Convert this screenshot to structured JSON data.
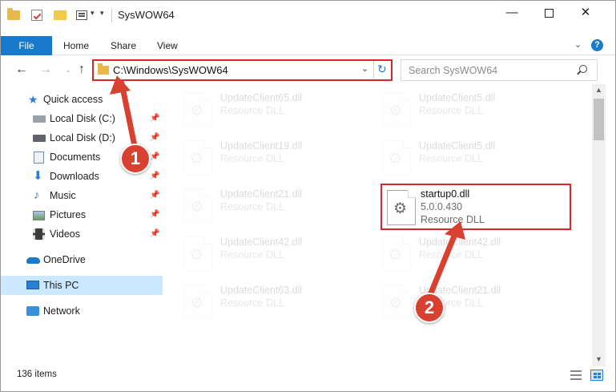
{
  "window": {
    "title": "SysWOW64",
    "controls": {
      "minimize": "—",
      "maximize": "",
      "close": "✕"
    }
  },
  "quick_access_toolbar": {
    "dropdown_glyph": "▾",
    "customize_glyph": "▾"
  },
  "ribbon": {
    "tabs": [
      "File",
      "Home",
      "Share",
      "View"
    ],
    "expand_glyph": "⌄",
    "help_glyph": "?"
  },
  "navigation": {
    "back_glyph": "←",
    "forward_glyph": "→",
    "recent_glyph": "⌄",
    "up_glyph": "↑",
    "address_path": "C:\\Windows\\SysWOW64",
    "address_dropdown_glyph": "⌄",
    "refresh_glyph": "↻",
    "search_placeholder": "Search SysWOW64"
  },
  "sidebar": {
    "items": [
      {
        "label": "Quick access",
        "icon": "star-icon",
        "pinned": false
      },
      {
        "label": "Local Disk (C:)",
        "icon": "drive-icon",
        "pinned": true
      },
      {
        "label": "Local Disk (D:)",
        "icon": "drive-icon",
        "pinned": true
      },
      {
        "label": "Documents",
        "icon": "documents-icon",
        "pinned": true
      },
      {
        "label": "Downloads",
        "icon": "download-icon",
        "pinned": true
      },
      {
        "label": "Music",
        "icon": "music-icon",
        "pinned": true
      },
      {
        "label": "Pictures",
        "icon": "pictures-icon",
        "pinned": true
      },
      {
        "label": "Videos",
        "icon": "videos-icon",
        "pinned": true
      },
      {
        "label": "OneDrive",
        "icon": "cloud-icon",
        "pinned": false
      },
      {
        "label": "This PC",
        "icon": "computer-icon",
        "pinned": false,
        "selected": true
      },
      {
        "label": "Network",
        "icon": "network-icon",
        "pinned": false
      }
    ],
    "pin_glyph": "📌"
  },
  "files": {
    "left_column": [
      {
        "name": "UpdateClient65.dll",
        "type": "Resource DLL"
      },
      {
        "name": "UpdateClient19.dll",
        "type": "Resource DLL"
      },
      {
        "name": "UpdateClient21.dll",
        "type": "Resource DLL"
      },
      {
        "name": "UpdateClient42.dll",
        "type": "Resource DLL"
      },
      {
        "name": "UpdateClient63.dll",
        "type": "Resource DLL"
      }
    ],
    "right_column": [
      {
        "name": "UpdateClient5.dll",
        "type": "Resource DLL"
      },
      {
        "name": "UpdateClient5.dll",
        "type": "Resource DLL"
      },
      {
        "name": "startup0.dll",
        "version": "5.0.0.430",
        "type": "Resource DLL",
        "highlighted": true
      },
      {
        "name": "UpdateClient42.dll",
        "type": "Resource DLL"
      },
      {
        "name": "UpdateClient21.dll",
        "type": "Resource DLL"
      }
    ]
  },
  "scrollbar": {
    "up_glyph": "▲",
    "down_glyph": "▼"
  },
  "status_bar": {
    "item_count": "136 items"
  },
  "annotations": {
    "callout_1": "1",
    "callout_2": "2",
    "highlight_color": "#d6272b",
    "callout_color": "#d84030"
  },
  "colors": {
    "accent": "#1979ca",
    "selection": "#cce8ff"
  }
}
